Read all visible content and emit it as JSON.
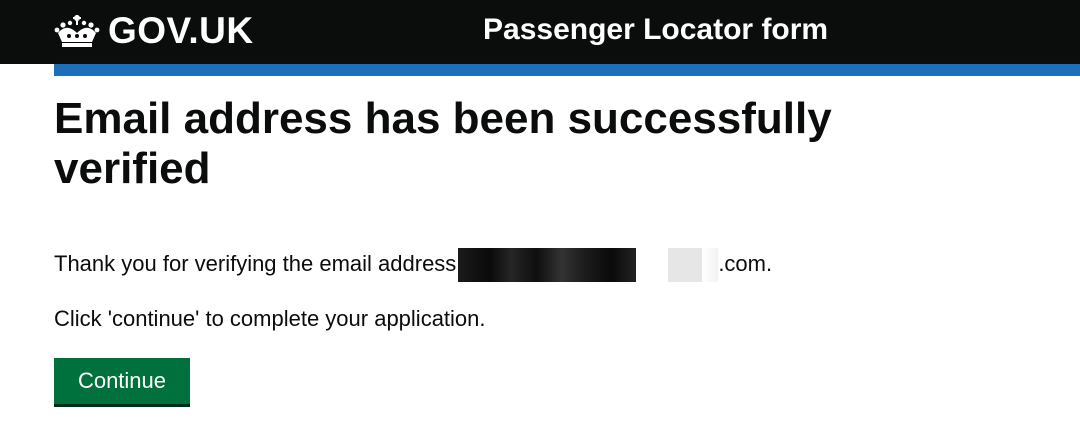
{
  "header": {
    "logo_text": "GOV.UK",
    "service_name": "Passenger Locator form",
    "crown_icon": "crown-icon"
  },
  "main": {
    "heading": "Email address has been successfully verified",
    "thanks_text": "Thank you for verifying the email address",
    "email_suffix": ".com",
    "period": ".",
    "instruction": "Click 'continue' to complete your application.",
    "continue_label": "Continue"
  },
  "colors": {
    "header_bg": "#0b0c0c",
    "accent_blue": "#1d70b8",
    "button_green": "#00703c",
    "text": "#0b0c0c"
  }
}
